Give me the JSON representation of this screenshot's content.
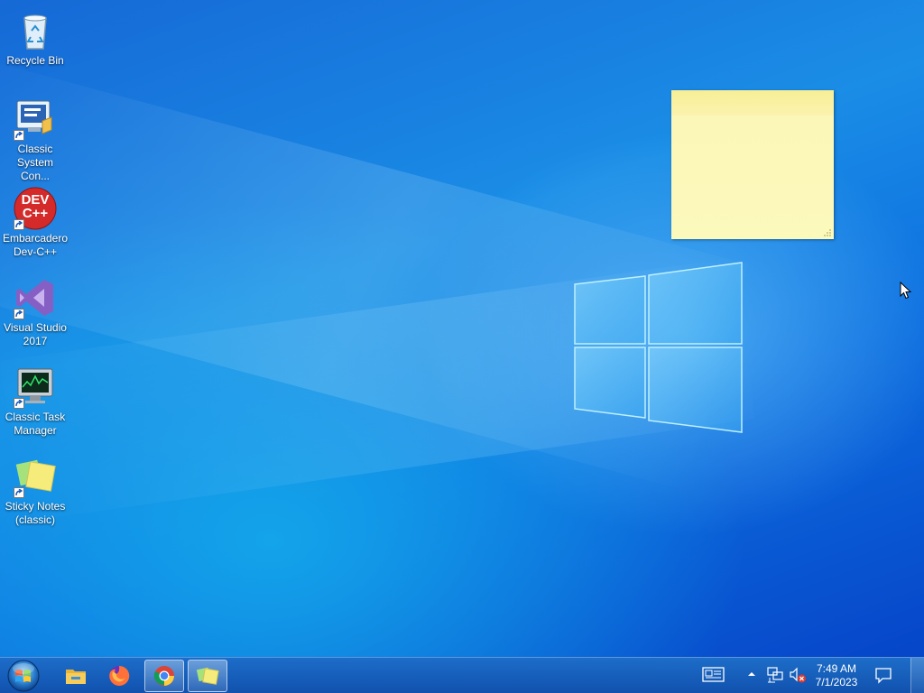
{
  "desktop": {
    "icons": [
      {
        "label_line1": "Recycle Bin",
        "label_line2": "",
        "icon": "recycle-bin-icon"
      },
      {
        "label_line1": "Classic",
        "label_line2": "System Con...",
        "icon": "control-panel-icon"
      },
      {
        "label_line1": "Embarcadero",
        "label_line2": "Dev-C++",
        "icon": "devcpp-icon",
        "badge_line1": "DEV",
        "badge_line2": "C++"
      },
      {
        "label_line1": "Visual Studio",
        "label_line2": "2017",
        "icon": "visual-studio-icon"
      },
      {
        "label_line1": "Classic Task",
        "label_line2": "Manager",
        "icon": "task-manager-icon"
      },
      {
        "label_line1": "Sticky Notes",
        "label_line2": "(classic)",
        "icon": "sticky-notes-icon"
      }
    ]
  },
  "sticky_note": {
    "text": ""
  },
  "taskbar": {
    "start": "windows-start-orb",
    "pinned": [
      {
        "name": "File Explorer",
        "icon": "folder-icon",
        "active": false
      },
      {
        "name": "Firefox",
        "icon": "firefox-icon",
        "active": false
      },
      {
        "name": "Chrome",
        "icon": "chrome-icon",
        "active": true
      },
      {
        "name": "Sticky Notes",
        "icon": "sticky-notes-icon",
        "active": true
      }
    ],
    "tray": {
      "time": "7:49 AM",
      "date": "7/1/2023",
      "icons": [
        "news-icon",
        "show-hidden-icons-chevron",
        "network-icon",
        "volume-muted-icon",
        "action-center-icon"
      ]
    }
  },
  "colors": {
    "desktop_blue": "#0a63d8",
    "taskbar": "#1e6ec8",
    "sticky_yellow": "#fcf9bd",
    "devcpp_red": "#d42a2a",
    "vs_purple": "#865fc5"
  }
}
